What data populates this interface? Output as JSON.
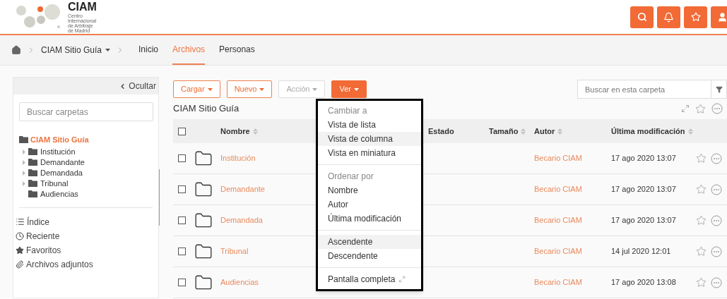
{
  "header": {
    "logo": {
      "name": "CIAM",
      "subtitle": [
        "Centro",
        "Internacional",
        "de Arbitraje",
        "de Madrid"
      ]
    }
  },
  "breadcrumb": [
    {
      "label": "CIAM Sitio Guía",
      "has_menu": true
    }
  ],
  "nav_tabs": [
    {
      "label": "Inicio",
      "selected": false
    },
    {
      "label": "Archivos",
      "selected": true
    },
    {
      "label": "Personas",
      "selected": false
    }
  ],
  "sidebar": {
    "hide_label": "Ocultar",
    "search": {
      "placeholder": "Buscar carpetas"
    },
    "tree": {
      "label": "CIAM Sitio Guía",
      "selected": true,
      "children": [
        {
          "label": "Institución",
          "expandable": true
        },
        {
          "label": "Demandante",
          "expandable": true
        },
        {
          "label": "Demandada",
          "expandable": true
        },
        {
          "label": "Tribunal",
          "expandable": true
        },
        {
          "label": "Audiencias",
          "expandable": false
        }
      ]
    },
    "links": [
      {
        "label": "Índice",
        "kind": "index"
      },
      {
        "label": "Reciente",
        "kind": "recent"
      },
      {
        "label": "Favoritos",
        "kind": "favorites"
      },
      {
        "label": "Archivos adjuntos",
        "kind": "attachments"
      }
    ]
  },
  "toolbar": {
    "buttons": [
      {
        "label": "Cargar",
        "disabled": false,
        "selected": false
      },
      {
        "label": "Nuevo",
        "disabled": false,
        "selected": false
      },
      {
        "label": "Acción",
        "disabled": true,
        "selected": false
      },
      {
        "label": "Ver",
        "disabled": false,
        "selected": true
      }
    ],
    "search": {
      "placeholder": "Buscar en esta carpeta"
    }
  },
  "folder_title": "CIAM Sitio Guía",
  "table": {
    "header_checked": false,
    "columns": [
      {
        "label": "Nombre",
        "sortable": true
      },
      {
        "label": "Estado",
        "sortable": false
      },
      {
        "label": "Tamaño",
        "sortable": true
      },
      {
        "label": "Autor",
        "sortable": true
      },
      {
        "label": "Última modificación",
        "sortable": true
      }
    ],
    "rows": [
      {
        "name": "Institución",
        "author": "Becario CIAM",
        "modified": "17 ago 2020 13:07",
        "checked": false
      },
      {
        "name": "Demandante",
        "author": "Becario CIAM",
        "modified": "17 ago 2020 13:07",
        "checked": false
      },
      {
        "name": "Demandada",
        "author": "Becario CIAM",
        "modified": "17 ago 2020 13:07",
        "checked": false
      },
      {
        "name": "Tribunal",
        "author": "Becario CIAM",
        "modified": "14 jul 2020 12:01",
        "checked": false
      },
      {
        "name": "Audiencias",
        "author": "Becario CIAM",
        "modified": "17 ago 2020 13:08",
        "checked": false
      }
    ]
  },
  "view_menu": {
    "sections": [
      {
        "heading": "Cambiar a",
        "items": [
          {
            "label": "Vista de lista",
            "kind": "plain",
            "selected": false
          },
          {
            "label": "Vista de columna",
            "kind": "plain",
            "selected": true
          },
          {
            "label": "Vista en miniatura",
            "kind": "plain",
            "selected": false
          }
        ]
      },
      {
        "heading": "Ordenar por",
        "items": [
          {
            "label": "Nombre",
            "kind": "plain",
            "selected": false
          },
          {
            "label": "Autor",
            "kind": "plain",
            "selected": false
          },
          {
            "label": "Última modificación",
            "kind": "plain",
            "selected": false
          }
        ]
      },
      {
        "items": [
          {
            "label": "Ascendente",
            "kind": "plain",
            "selected": true
          },
          {
            "label": "Descendente",
            "kind": "plain",
            "selected": false
          }
        ]
      },
      {
        "items": [
          {
            "label": "Pantalla completa",
            "kind": "fullscreen",
            "selected": false
          }
        ]
      }
    ]
  }
}
